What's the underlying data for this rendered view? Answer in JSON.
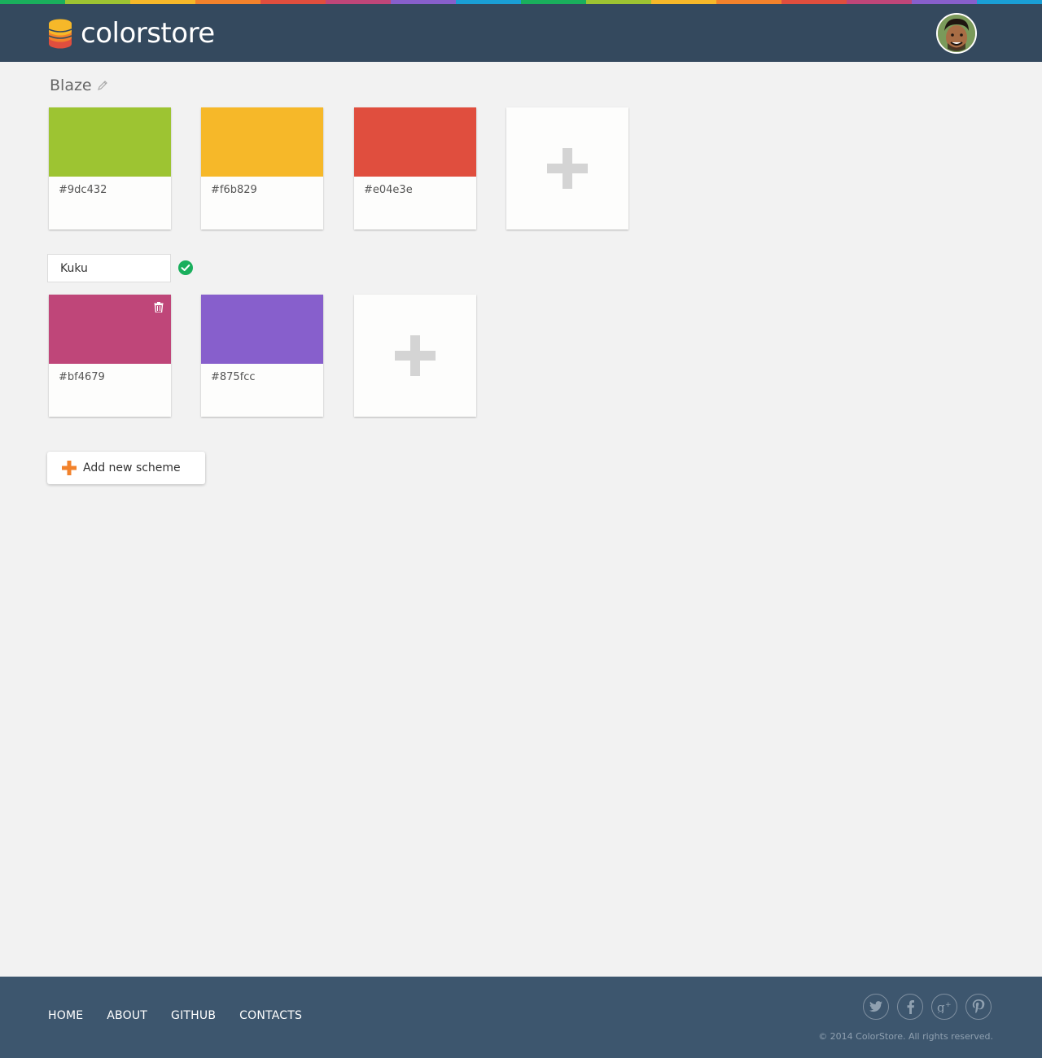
{
  "brand": {
    "name": "colorstore",
    "rainbow_colors": [
      "#1aaf5d",
      "#9dc432",
      "#f6b829",
      "#f2822b",
      "#e04e3e",
      "#bf4679",
      "#875fcc",
      "#1a9fd6",
      "#1aaf5d",
      "#9dc432",
      "#f6b829",
      "#f2822b",
      "#e04e3e",
      "#bf4679",
      "#875fcc",
      "#1a9fd6"
    ],
    "header_color": "#34495e"
  },
  "schemes": [
    {
      "name": "Blaze",
      "editing": false,
      "colors": [
        {
          "hex": "#9dc432"
        },
        {
          "hex": "#f6b829"
        },
        {
          "hex": "#e04e3e"
        }
      ]
    },
    {
      "name": "Kuku",
      "editing": true,
      "colors": [
        {
          "hex": "#bf4679"
        },
        {
          "hex": "#875fcc"
        }
      ]
    }
  ],
  "actions": {
    "add_scheme_label": "Add new scheme"
  },
  "footer": {
    "nav": [
      "HOME",
      "ABOUT",
      "GITHUB",
      "CONTACTS"
    ],
    "social_icons": [
      "twitter-icon",
      "facebook-icon",
      "google-plus-icon",
      "pinterest-icon"
    ],
    "copyright": "© 2014 ColorStore. All rights reserved."
  }
}
